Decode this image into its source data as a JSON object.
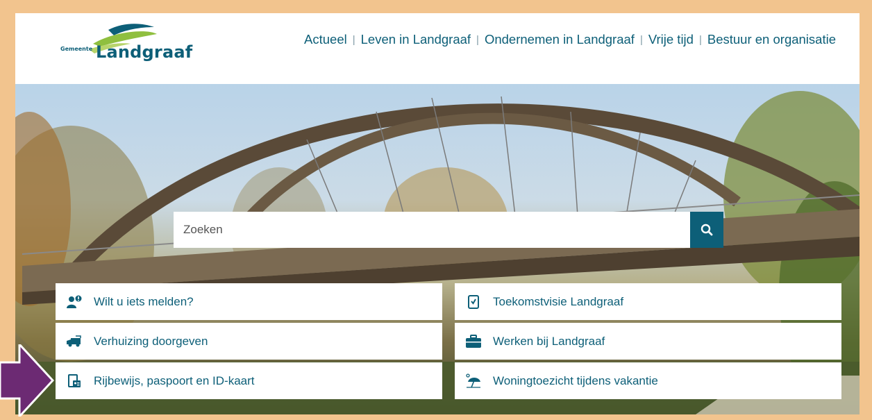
{
  "header": {
    "logo_small": "Gemeente",
    "logo_name": "Landgraaf",
    "nav": [
      {
        "label": "Actueel"
      },
      {
        "label": "Leven in Landgraaf"
      },
      {
        "label": "Ondernemen in Landgraaf"
      },
      {
        "label": "Vrije tijd"
      },
      {
        "label": "Bestuur en organisatie"
      }
    ],
    "nav_separator": "|"
  },
  "search": {
    "placeholder": "Zoeken",
    "value": ""
  },
  "tiles": {
    "left": [
      {
        "label": "Wilt u iets melden?",
        "icon": "person-alert-icon"
      },
      {
        "label": "Verhuizing doorgeven",
        "icon": "moving-truck-icon"
      },
      {
        "label": "Rijbewijs, paspoort en ID-kaart",
        "icon": "id-card-icon"
      }
    ],
    "right": [
      {
        "label": "Toekomstvisie Landgraaf",
        "icon": "document-check-icon"
      },
      {
        "label": "Werken bij Landgraaf",
        "icon": "briefcase-icon"
      },
      {
        "label": "Woningtoezicht tijdens vakantie",
        "icon": "beach-umbrella-icon"
      }
    ]
  },
  "colors": {
    "brand": "#0d5f78",
    "frame": "#f2c48e",
    "arrow": "#6c2a73",
    "logo_green": "#8fbf3f"
  }
}
